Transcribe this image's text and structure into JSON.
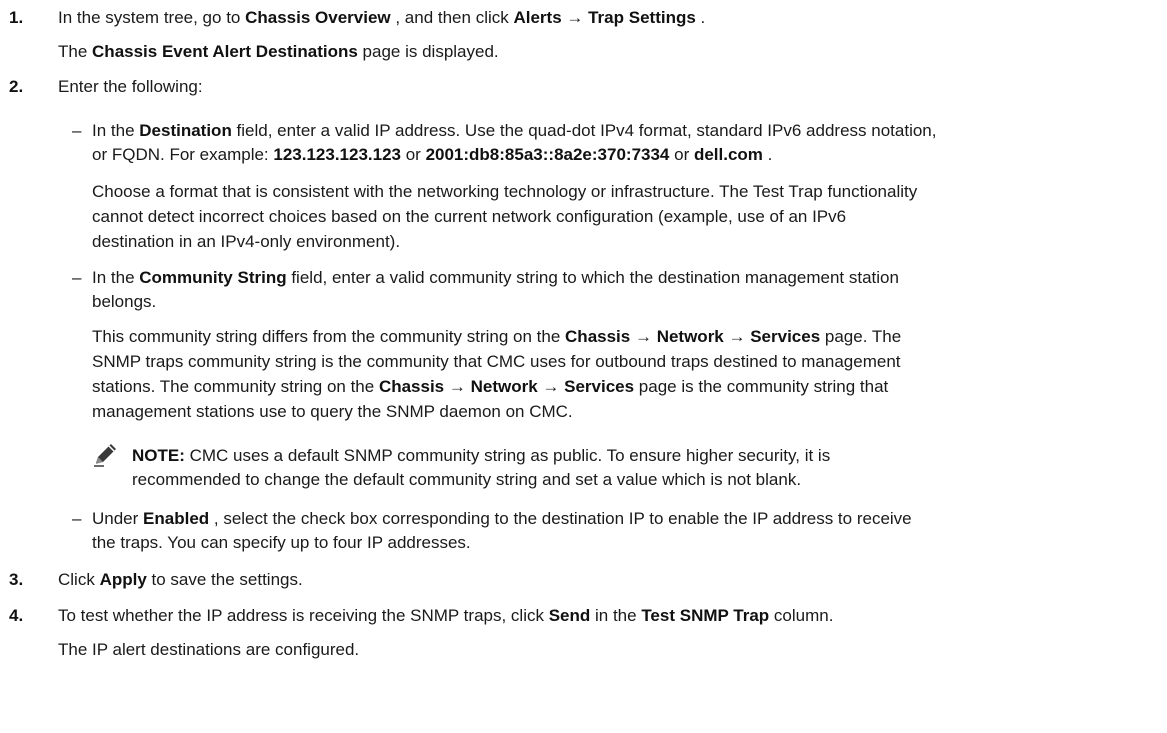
{
  "steps": [
    {
      "number": "1.",
      "text_a": "In the system tree, go to ",
      "bold_a": "Chassis Overview",
      "text_b": " , and then click ",
      "bold_b": "Alerts",
      "arrow": " → ",
      "bold_c": "Trap Settings",
      "text_c": " .",
      "result_a": "The ",
      "result_bold": "Chassis Event Alert Destinations",
      "result_b": " page is displayed."
    },
    {
      "number": "2.",
      "text": "Enter the following:"
    },
    {
      "number": "3.",
      "text_a": "Click ",
      "bold": "Apply",
      "text_b": " to save the settings."
    },
    {
      "number": "4.",
      "text_a": "To test whether the IP address is receiving the SNMP traps, click ",
      "bold_a": "Send",
      "text_b": " in the ",
      "bold_b": "Test SNMP Trap",
      "text_c": " column.",
      "result": "The IP alert destinations are configured."
    }
  ],
  "bullets": {
    "dash": "–",
    "destination": {
      "l1_a": "In the ",
      "l1_bold": "Destination",
      "l1_b": " field, enter a valid IP address. Use the quad-dot IPv4 format, standard IPv6 address notation,",
      "l2_a": "or FQDN. For example: ",
      "l2_bold1": "123.123.123.123",
      "l2_or1": " or ",
      "l2_bold2": "2001:db8:85a3::8a2e:370:7334",
      "l2_or2": " or ",
      "l2_bold3": "dell.com",
      "l2_end": " .",
      "p1": "Choose a format that is consistent with the networking technology or infrastructure. The Test Trap functionality",
      "p2": "cannot detect incorrect choices based on the current network configuration (example, use of an IPv6",
      "p3": "destination in an IPv4-only environment)."
    },
    "community": {
      "l1_a": "In the ",
      "l1_bold": "Community String",
      "l1_b": " field, enter a valid community string to which the destination management station",
      "l2": "belongs.",
      "p1_a": "This community string differs from the community string on the ",
      "p1_bold1": "Chassis",
      "p1_arrow1": " → ",
      "p1_bold2": "Network",
      "p1_arrow2": " → ",
      "p1_bold3": "Services",
      "p1_b": " page. The",
      "p2": "SNMP traps community string is the community that CMC uses for outbound traps destined to management",
      "p3_a": "stations. The community string on the ",
      "p3_bold1": "Chassis",
      "p3_arrow1": " → ",
      "p3_bold2": "Network",
      "p3_arrow2": " → ",
      "p3_bold3": "Services",
      "p3_b": " page is the community string that",
      "p4": "management stations use to query the SNMP daemon on CMC."
    },
    "note": {
      "label": "NOTE:",
      "l1": " CMC uses a default SNMP community string as public. To ensure higher security, it is",
      "l2": "recommended to change the default community string and set a value which is not blank."
    },
    "enabled": {
      "l1_a": "Under ",
      "l1_bold": "Enabled",
      "l1_b": " , select the check box corresponding to the destination IP to enable the IP address to receive",
      "l2": "the traps. You can specify up to four IP addresses."
    }
  }
}
